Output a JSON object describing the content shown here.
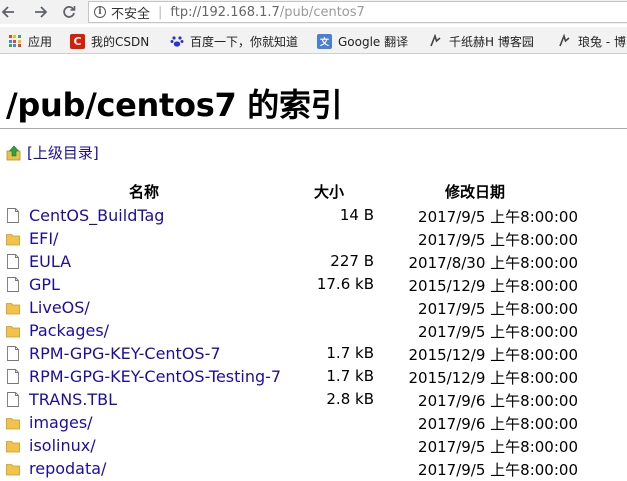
{
  "browser": {
    "security_label": "不安全",
    "url_host": "ftp://192.168.1.7",
    "url_path": "/pub/centos7"
  },
  "bookmarks": [
    {
      "label": "应用",
      "icon": "apps-grid-icon"
    },
    {
      "label": "我的CSDN",
      "icon": "csdn-icon"
    },
    {
      "label": "百度一下，你就知道",
      "icon": "baidu-paw-icon"
    },
    {
      "label": "Google 翻译",
      "icon": "google-translate-icon"
    },
    {
      "label": "千纸赫H 博客园",
      "icon": "cnblogs-icon"
    },
    {
      "label": "琅兔 - 博",
      "icon": "cnblogs-icon"
    }
  ],
  "page": {
    "title": "/pub/centos7 的索引",
    "parent_link": "[上级目录]",
    "columns": {
      "name": "名称",
      "size": "大小",
      "modified": "修改日期"
    }
  },
  "files": [
    {
      "name": "CentOS_BuildTag",
      "type": "file",
      "size": "14 B",
      "date": "2017/9/5 上午8:00:00"
    },
    {
      "name": "EFI/",
      "type": "folder",
      "size": "",
      "date": "2017/9/5 上午8:00:00"
    },
    {
      "name": "EULA",
      "type": "file",
      "size": "227 B",
      "date": "2017/8/30 上午8:00:00"
    },
    {
      "name": "GPL",
      "type": "file",
      "size": "17.6 kB",
      "date": "2015/12/9 上午8:00:00"
    },
    {
      "name": "LiveOS/",
      "type": "folder",
      "size": "",
      "date": "2017/9/5 上午8:00:00"
    },
    {
      "name": "Packages/",
      "type": "folder",
      "size": "",
      "date": "2017/9/5 上午8:00:00"
    },
    {
      "name": "RPM-GPG-KEY-CentOS-7",
      "type": "file",
      "size": "1.7 kB",
      "date": "2015/12/9 上午8:00:00"
    },
    {
      "name": "RPM-GPG-KEY-CentOS-Testing-7",
      "type": "file",
      "size": "1.7 kB",
      "date": "2015/12/9 上午8:00:00"
    },
    {
      "name": "TRANS.TBL",
      "type": "file",
      "size": "2.8 kB",
      "date": "2017/9/6 上午8:00:00"
    },
    {
      "name": "images/",
      "type": "folder",
      "size": "",
      "date": "2017/9/6 上午8:00:00"
    },
    {
      "name": "isolinux/",
      "type": "folder",
      "size": "",
      "date": "2017/9/5 上午8:00:00"
    },
    {
      "name": "repodata/",
      "type": "folder",
      "size": "",
      "date": "2017/9/5 上午8:00:00"
    }
  ],
  "colors": {
    "link": "#1a0dab",
    "folder": "#f3c24a",
    "rule": "#a9a9a9"
  }
}
